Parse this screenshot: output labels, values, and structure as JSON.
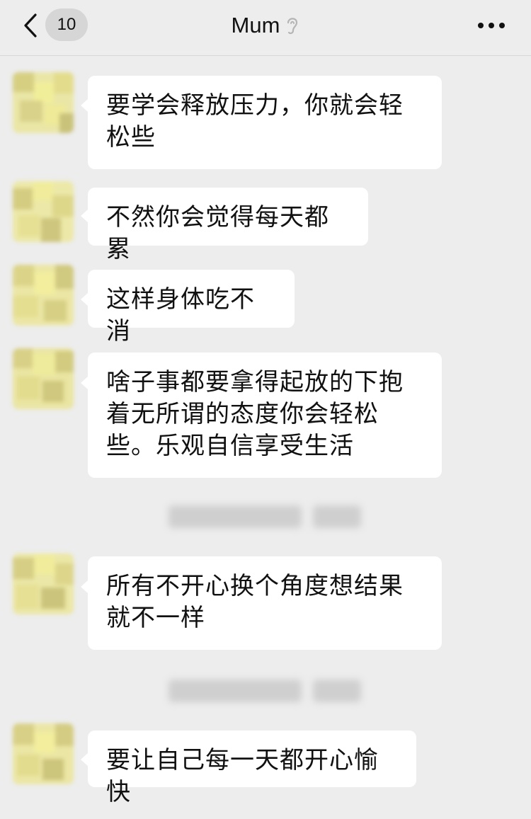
{
  "header": {
    "badge_count": "10",
    "title": "Mum"
  },
  "messages": [
    {
      "text": "要学会释放压力，你就会轻松些"
    },
    {
      "text": "不然你会觉得每天都累"
    },
    {
      "text": "这样身体吃不消"
    },
    {
      "text": "啥子事都要拿得起放的下抱着无所谓的态度你会轻松些。乐观自信享受生活"
    },
    {
      "text": "所有不开心换个角度想结果就不一样"
    },
    {
      "text": "要让自己每一天都开心愉快"
    }
  ],
  "colors": {
    "background": "#ededed",
    "bubble": "#ffffff",
    "avatar_yellow": "#e8e39a"
  },
  "icons": {
    "back": "chevron-left-icon",
    "ear": "ear-icon",
    "more": "more-dots-icon"
  }
}
